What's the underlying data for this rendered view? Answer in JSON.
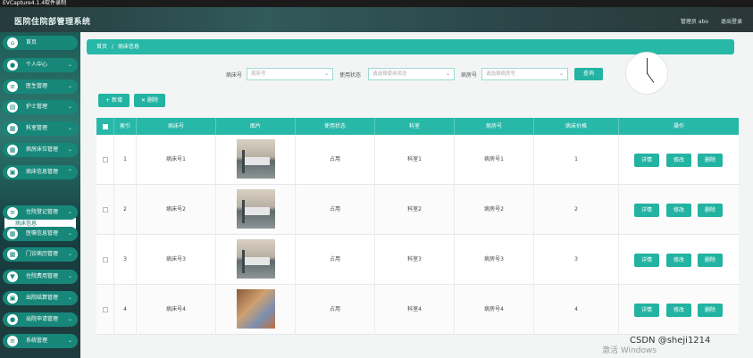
{
  "capture_title": "EVCapture4.1.4软件录制",
  "header": {
    "title": "医院住院部管理系统",
    "user": "管理员 abo",
    "logout": "退出登录"
  },
  "sidebar": {
    "items": [
      {
        "label": "首页"
      },
      {
        "label": "个人中心"
      },
      {
        "label": "医生管理"
      },
      {
        "label": "护士管理"
      },
      {
        "label": "科室管理"
      },
      {
        "label": "病房床位管理"
      },
      {
        "label": "病床信息管理"
      },
      {
        "label": "住院登记管理"
      },
      {
        "label": "医嘱信息管理"
      },
      {
        "label": "门诊病历管理"
      },
      {
        "label": "住院费用管理"
      },
      {
        "label": "出院结算管理"
      },
      {
        "label": "出院申请管理"
      },
      {
        "label": "系统管理"
      }
    ],
    "active_sub": "病床信息"
  },
  "breadcrumb": {
    "home": "首页",
    "current": "病床信息"
  },
  "search": {
    "bed_label": "病床号",
    "bed_placeholder": "病床号",
    "status_label": "使用状态",
    "status_placeholder": "请选择使用状态",
    "ward_label": "病房号",
    "ward_placeholder": "请选择病房号",
    "query": "查询"
  },
  "toolbar": {
    "add": "+ 新增",
    "delete": "✕ 删除"
  },
  "table": {
    "headers": [
      "索引",
      "病床号",
      "图片",
      "使用状态",
      "科室",
      "病房号",
      "病床价格",
      "操作"
    ],
    "rows": [
      {
        "index": "1",
        "bed": "病床号1",
        "status": "占用",
        "dept": "科室1",
        "ward": "病房号1",
        "price": "1",
        "img": "bed"
      },
      {
        "index": "2",
        "bed": "病床号2",
        "status": "占用",
        "dept": "科室2",
        "ward": "病房号2",
        "price": "2",
        "img": "bed"
      },
      {
        "index": "3",
        "bed": "病床号3",
        "status": "占用",
        "dept": "科室3",
        "ward": "病房号3",
        "price": "3",
        "img": "bed"
      },
      {
        "index": "4",
        "bed": "病床号4",
        "status": "占用",
        "dept": "科室4",
        "ward": "病房号4",
        "price": "4",
        "img": "room"
      }
    ],
    "actions": {
      "detail": "详情",
      "edit": "修改",
      "remove": "删除"
    }
  },
  "watermark": "CSDN @sheji1214",
  "windows_watermark": "激活 Windows"
}
